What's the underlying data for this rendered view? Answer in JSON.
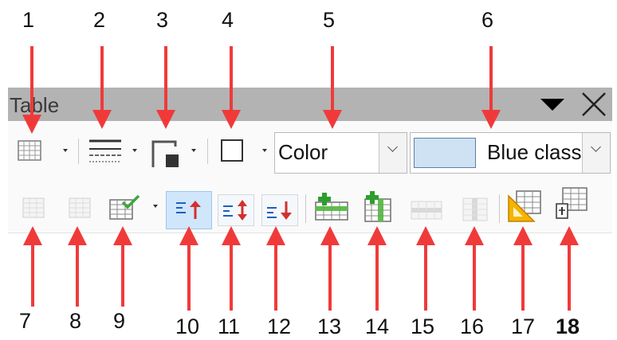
{
  "panel": {
    "title": "Table",
    "menu_icon": "triangle-down-icon",
    "close_icon": "close-icon"
  },
  "toolbar": {
    "row1": [
      {
        "name": "insert-table",
        "icon": "grid-icon",
        "has_dropdown": true
      },
      {
        "name": "border-style",
        "icon": "border-style-icon",
        "has_dropdown": true
      },
      {
        "name": "border-color",
        "icon": "border-color-icon",
        "has_dropdown": true
      },
      {
        "name": "borders",
        "icon": "borders-icon",
        "has_dropdown": true
      }
    ],
    "area_style_combo": {
      "value": "Color"
    },
    "fill_combo": {
      "value": "Blue classic",
      "swatch_color": "#cfe2f3"
    },
    "row2": [
      {
        "name": "merge-cells",
        "icon": "merge-icon",
        "enabled": false
      },
      {
        "name": "split-cells",
        "icon": "split-icon",
        "enabled": false
      },
      {
        "name": "optimize",
        "icon": "optimize-icon",
        "has_dropdown": true
      },
      {
        "name": "align-top",
        "icon": "align-top-icon",
        "pressed": true
      },
      {
        "name": "center-vertically",
        "icon": "center-vertically-icon"
      },
      {
        "name": "align-bottom",
        "icon": "align-bottom-icon"
      },
      {
        "name": "insert-rows",
        "icon": "insert-rows-icon"
      },
      {
        "name": "insert-columns",
        "icon": "insert-columns-icon"
      },
      {
        "name": "delete-rows",
        "icon": "delete-rows-icon",
        "enabled": false
      },
      {
        "name": "delete-columns",
        "icon": "delete-columns-icon",
        "enabled": false
      },
      {
        "name": "table-design",
        "icon": "table-design-icon"
      },
      {
        "name": "table-properties",
        "icon": "table-properties-icon"
      }
    ]
  },
  "callouts": [
    "1",
    "2",
    "3",
    "4",
    "5",
    "6",
    "7",
    "8",
    "9",
    "10",
    "11",
    "12",
    "13",
    "14",
    "15",
    "16",
    "17",
    "18"
  ],
  "colors": {
    "arrow": "#f03a3a",
    "title_bar": "#b3b3b3",
    "toolbar_bg": "#fafafa",
    "pressed_bg": "#cfe6fb",
    "blue_arrow": "#1d5fbf",
    "red_arrow_icon": "#d32f2f",
    "green": "#2e9d2e"
  }
}
